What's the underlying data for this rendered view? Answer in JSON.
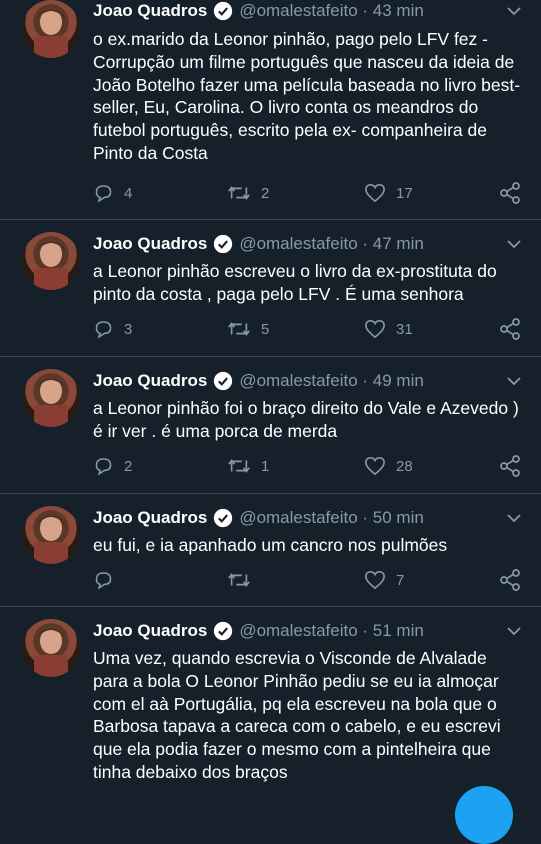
{
  "tweets": [
    {
      "name": "Joao Quadros",
      "handle": "@omalestafeito",
      "time": "43 min",
      "text": "o ex.marido da Leonor pinhão, pago pelo LFV fez - Corrupção um filme português que nasceu da ideia de João Botelho fazer uma película baseada no livro best-seller, Eu, Carolina. O livro conta os meandros do futebol português, escrito pela ex- companheira de Pinto da Costa",
      "replies": "4",
      "retweets": "2",
      "likes": "17"
    },
    {
      "name": "Joao Quadros",
      "handle": "@omalestafeito",
      "time": "47 min",
      "text": "a Leonor pinhão escreveu o livro da ex-prostituta do pinto da costa , paga pelo LFV . É uma senhora",
      "replies": "3",
      "retweets": "5",
      "likes": "31"
    },
    {
      "name": "Joao Quadros",
      "handle": "@omalestafeito",
      "time": "49 min",
      "text": "a Leonor pinhão foi o braço direito do Vale e Azevedo ) é ir ver . é uma porca de merda",
      "replies": "2",
      "retweets": "1",
      "likes": "28"
    },
    {
      "name": "Joao Quadros",
      "handle": "@omalestafeito",
      "time": "50 min",
      "text": "eu fui, e ia apanhado um cancro nos pulmões",
      "replies": "",
      "retweets": "",
      "likes": "7"
    },
    {
      "name": "Joao Quadros",
      "handle": "@omalestafeito",
      "time": "51 min",
      "text": "Uma vez, quando escrevia o Visconde de Alvalade para a bola O Leonor Pinhão pediu se eu ia almoçar com el aà Portugália, pq ela escreveu na bola que o Barbosa tapava a careca com o cabelo, e eu escrevi que ela podia fazer o mesmo com a pintelheira que tinha debaixo dos braços",
      "replies": "",
      "retweets": "",
      "likes": ""
    }
  ],
  "colors": {
    "background": "#15202b",
    "secondary_text": "#8899a6",
    "divider": "#38444d",
    "verified": "#1da1f2"
  },
  "icons": [
    "reply-icon",
    "retweet-icon",
    "like-icon",
    "share-icon",
    "verified-icon",
    "chevron-down-icon"
  ]
}
